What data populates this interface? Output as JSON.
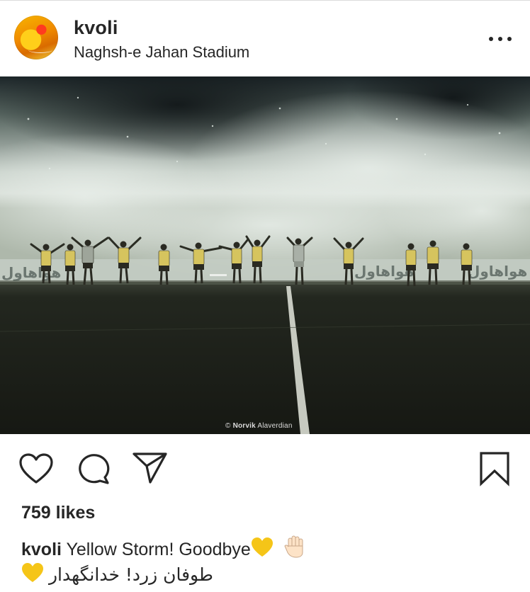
{
  "post": {
    "username": "kvoli",
    "location": "Naghsh-e Jahan Stadium",
    "photo_credit_symbol": "©",
    "photo_credit_first": "Norvik",
    "photo_credit_last": "Alaverdian",
    "banner_text": "هواهاول",
    "likes": "759 likes",
    "caption_user": "kvoli",
    "caption_text": "Yellow Storm! Goodbye",
    "caption_emoji_1": "yellow-heart",
    "caption_emoji_2": "raised-hand",
    "caption_line2": "طوفان زرد! خدانگهدار",
    "caption_line2_emoji": "yellow-heart"
  },
  "icons": {
    "avatar": "profile-photo",
    "more": "more-dots-icon",
    "like": "heart-icon",
    "comment": "comment-bubble-icon",
    "share": "paper-plane-icon",
    "save": "bookmark-icon"
  },
  "colors": {
    "text": "#262626",
    "divider": "#dbdbdb",
    "jersey_yellow": "#d8c25a",
    "smoke": "#c9d2cb",
    "pitch": "#1c1f19",
    "emoji_yellow": "#f5c518"
  }
}
